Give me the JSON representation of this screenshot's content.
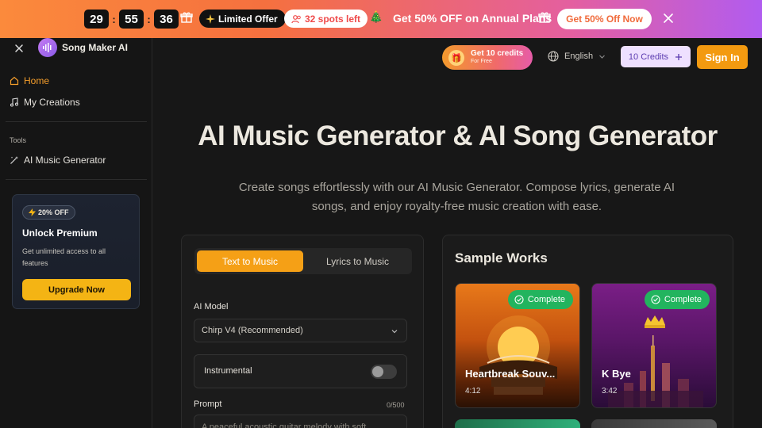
{
  "promo": {
    "timer": {
      "hours": "29",
      "minutes": "55",
      "seconds": "36",
      "sep": ":"
    },
    "limited_offer": "Limited Offer",
    "spots_left": "32 spots left",
    "headline": "Get 50% OFF on Annual Plans",
    "cta": "Get 50% Off Now"
  },
  "sidebar": {
    "brand": "Song Maker AI",
    "nav": [
      {
        "label": "Home",
        "icon": "home-icon"
      },
      {
        "label": "My Creations",
        "icon": "music-note-icon"
      }
    ],
    "tools_label": "Tools",
    "tools": [
      {
        "label": "AI Music Generator",
        "icon": "magic-wand-icon"
      }
    ],
    "premium_card": {
      "discount": "20% OFF",
      "title": "Unlock Premium",
      "description": "Get unlimited access to all features",
      "button": "Upgrade Now"
    }
  },
  "header": {
    "credit_promo_title": "Get 10 credits",
    "credit_promo_sub": "For Free",
    "language": "English",
    "credits": "10 Credits",
    "signin": "Sign In"
  },
  "hero": {
    "title": "AI Music Generator & AI Song Generator",
    "subtitle": "Create songs effortlessly with our AI Music Generator. Compose lyrics, generate AI songs, and enjoy royalty-free music creation with ease."
  },
  "generator": {
    "tabs": [
      "Text to Music",
      "Lyrics to Music"
    ],
    "model_label": "AI Model",
    "model_value": "Chirp V4 (Recommended)",
    "instrumental_label": "Instrumental",
    "prompt_label": "Prompt",
    "prompt_counter": "0/500",
    "prompt_placeholder": "A peaceful acoustic guitar melody with soft"
  },
  "samples": {
    "title": "Sample Works",
    "items": [
      {
        "title": "Heartbreak Souv...",
        "duration": "4:12",
        "status": "Complete"
      },
      {
        "title": "K Bye",
        "duration": "3:42",
        "status": "Complete"
      }
    ]
  },
  "colors": {
    "accent": "#f5a016",
    "success": "#22b45e",
    "background": "#171717"
  }
}
